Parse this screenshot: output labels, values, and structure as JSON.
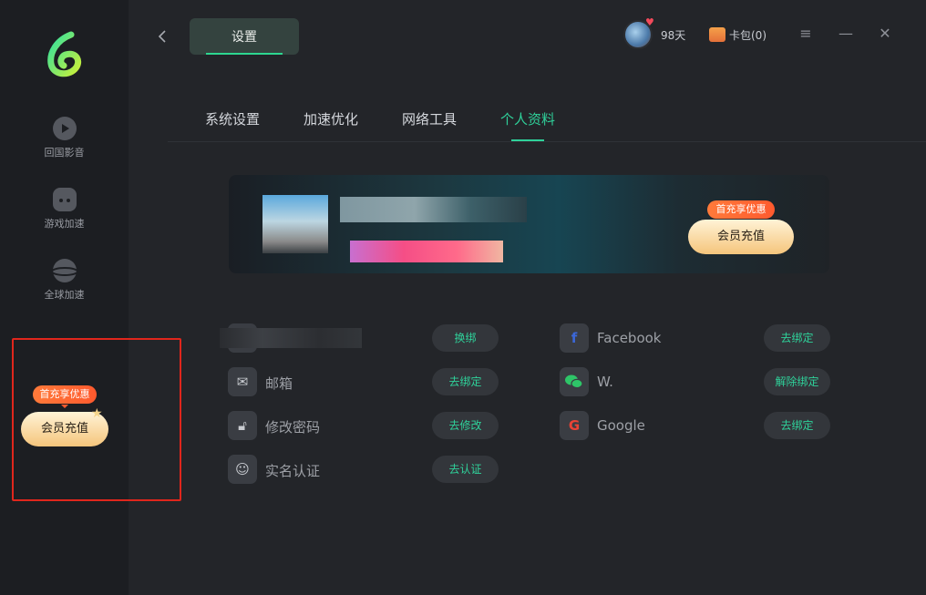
{
  "app": {
    "title": "设置"
  },
  "sidebar": {
    "items": [
      {
        "label": "回国影音",
        "icon": "play-icon"
      },
      {
        "label": "游戏加速",
        "icon": "gamepad-icon"
      },
      {
        "label": "全球加速",
        "icon": "planet-icon"
      }
    ],
    "promo": {
      "badge": "首充享优惠",
      "button": "会员充值"
    }
  },
  "header": {
    "back_icon": "chevron-left-icon",
    "tab_label": "设置",
    "days": "98天",
    "wallet": "卡包(0)",
    "menu_icon": "menu-icon",
    "minimize_icon": "minimize-icon",
    "close_icon": "close-icon"
  },
  "subtabs": [
    "系统设置",
    "加速优化",
    "网络工具",
    "个人资料"
  ],
  "active_subtab": "个人资料",
  "banner": {
    "badge": "首充享优惠",
    "button": "会员充值"
  },
  "left_rows": [
    {
      "label": "",
      "icon": "phone-icon",
      "action": "换绑"
    },
    {
      "label": "邮箱",
      "icon": "mail-icon",
      "action": "去绑定"
    },
    {
      "label": "修改密码",
      "icon": "lock-icon",
      "action": "去修改"
    },
    {
      "label": "实名认证",
      "icon": "id-user-icon",
      "action": "去认证"
    }
  ],
  "right_rows": [
    {
      "label": "Facebook",
      "icon": "facebook-icon",
      "action": "去绑定"
    },
    {
      "label": "W.",
      "icon": "wechat-icon",
      "action": "解除绑定"
    },
    {
      "label": "Google",
      "icon": "google-icon",
      "action": "去绑定"
    }
  ],
  "colors": {
    "accent": "#2fd19a",
    "promo_orange": "#ff6a36",
    "highlight_box": "#e0261c"
  }
}
